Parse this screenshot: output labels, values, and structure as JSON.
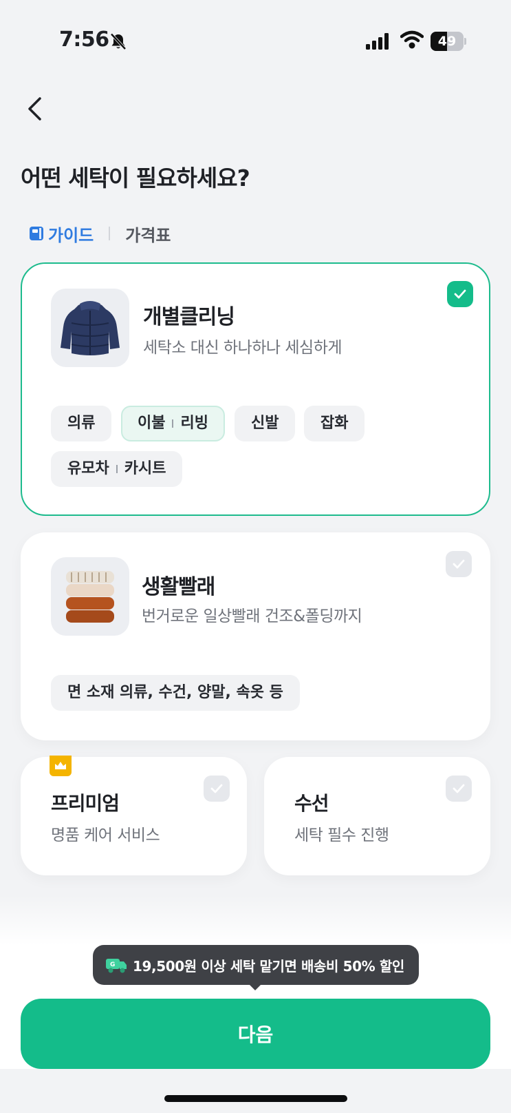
{
  "status_bar": {
    "time": "7:56",
    "battery_level": "49",
    "battery_fraction": 0.49
  },
  "header": {
    "title": "어떤 세탁이 필요하세요?"
  },
  "links": {
    "guide": "가이드",
    "price_table": "가격표"
  },
  "colors": {
    "accent": "#14bc8a",
    "link": "#2f7be0",
    "premium_badge": "#f4b400",
    "tooltip_bg": "#3f4146"
  },
  "services": [
    {
      "title": "개별클리닝",
      "description": "세탁소 대신 하나하나 세심하게",
      "selected": true,
      "thumbnail_icon": "puffer-jacket-image",
      "chips": [
        {
          "label": "의류"
        },
        {
          "left": "이불",
          "right": "리빙",
          "active": true
        },
        {
          "label": "신발"
        },
        {
          "label": "잡화"
        },
        {
          "left": "유모차",
          "right": "카시트"
        }
      ]
    },
    {
      "title": "생활빨래",
      "description": "번거로운 일상빨래 건조&폴딩까지",
      "selected": false,
      "thumbnail_icon": "folded-towels-image",
      "chips": [
        {
          "label": "면 소재 의류, 수건, 양말, 속옷 등"
        }
      ]
    },
    {
      "title": "프리미엄",
      "description": "명품 케어 서비스",
      "selected": false,
      "badge_icon": "crown-icon"
    },
    {
      "title": "수선",
      "description": "세탁 필수 진행",
      "selected": false
    }
  ],
  "promo": {
    "text": "19,500원 이상 세탁 맡기면 배송비 50% 할인",
    "icon": "delivery-truck-icon"
  },
  "next_button": {
    "label": "다음"
  }
}
